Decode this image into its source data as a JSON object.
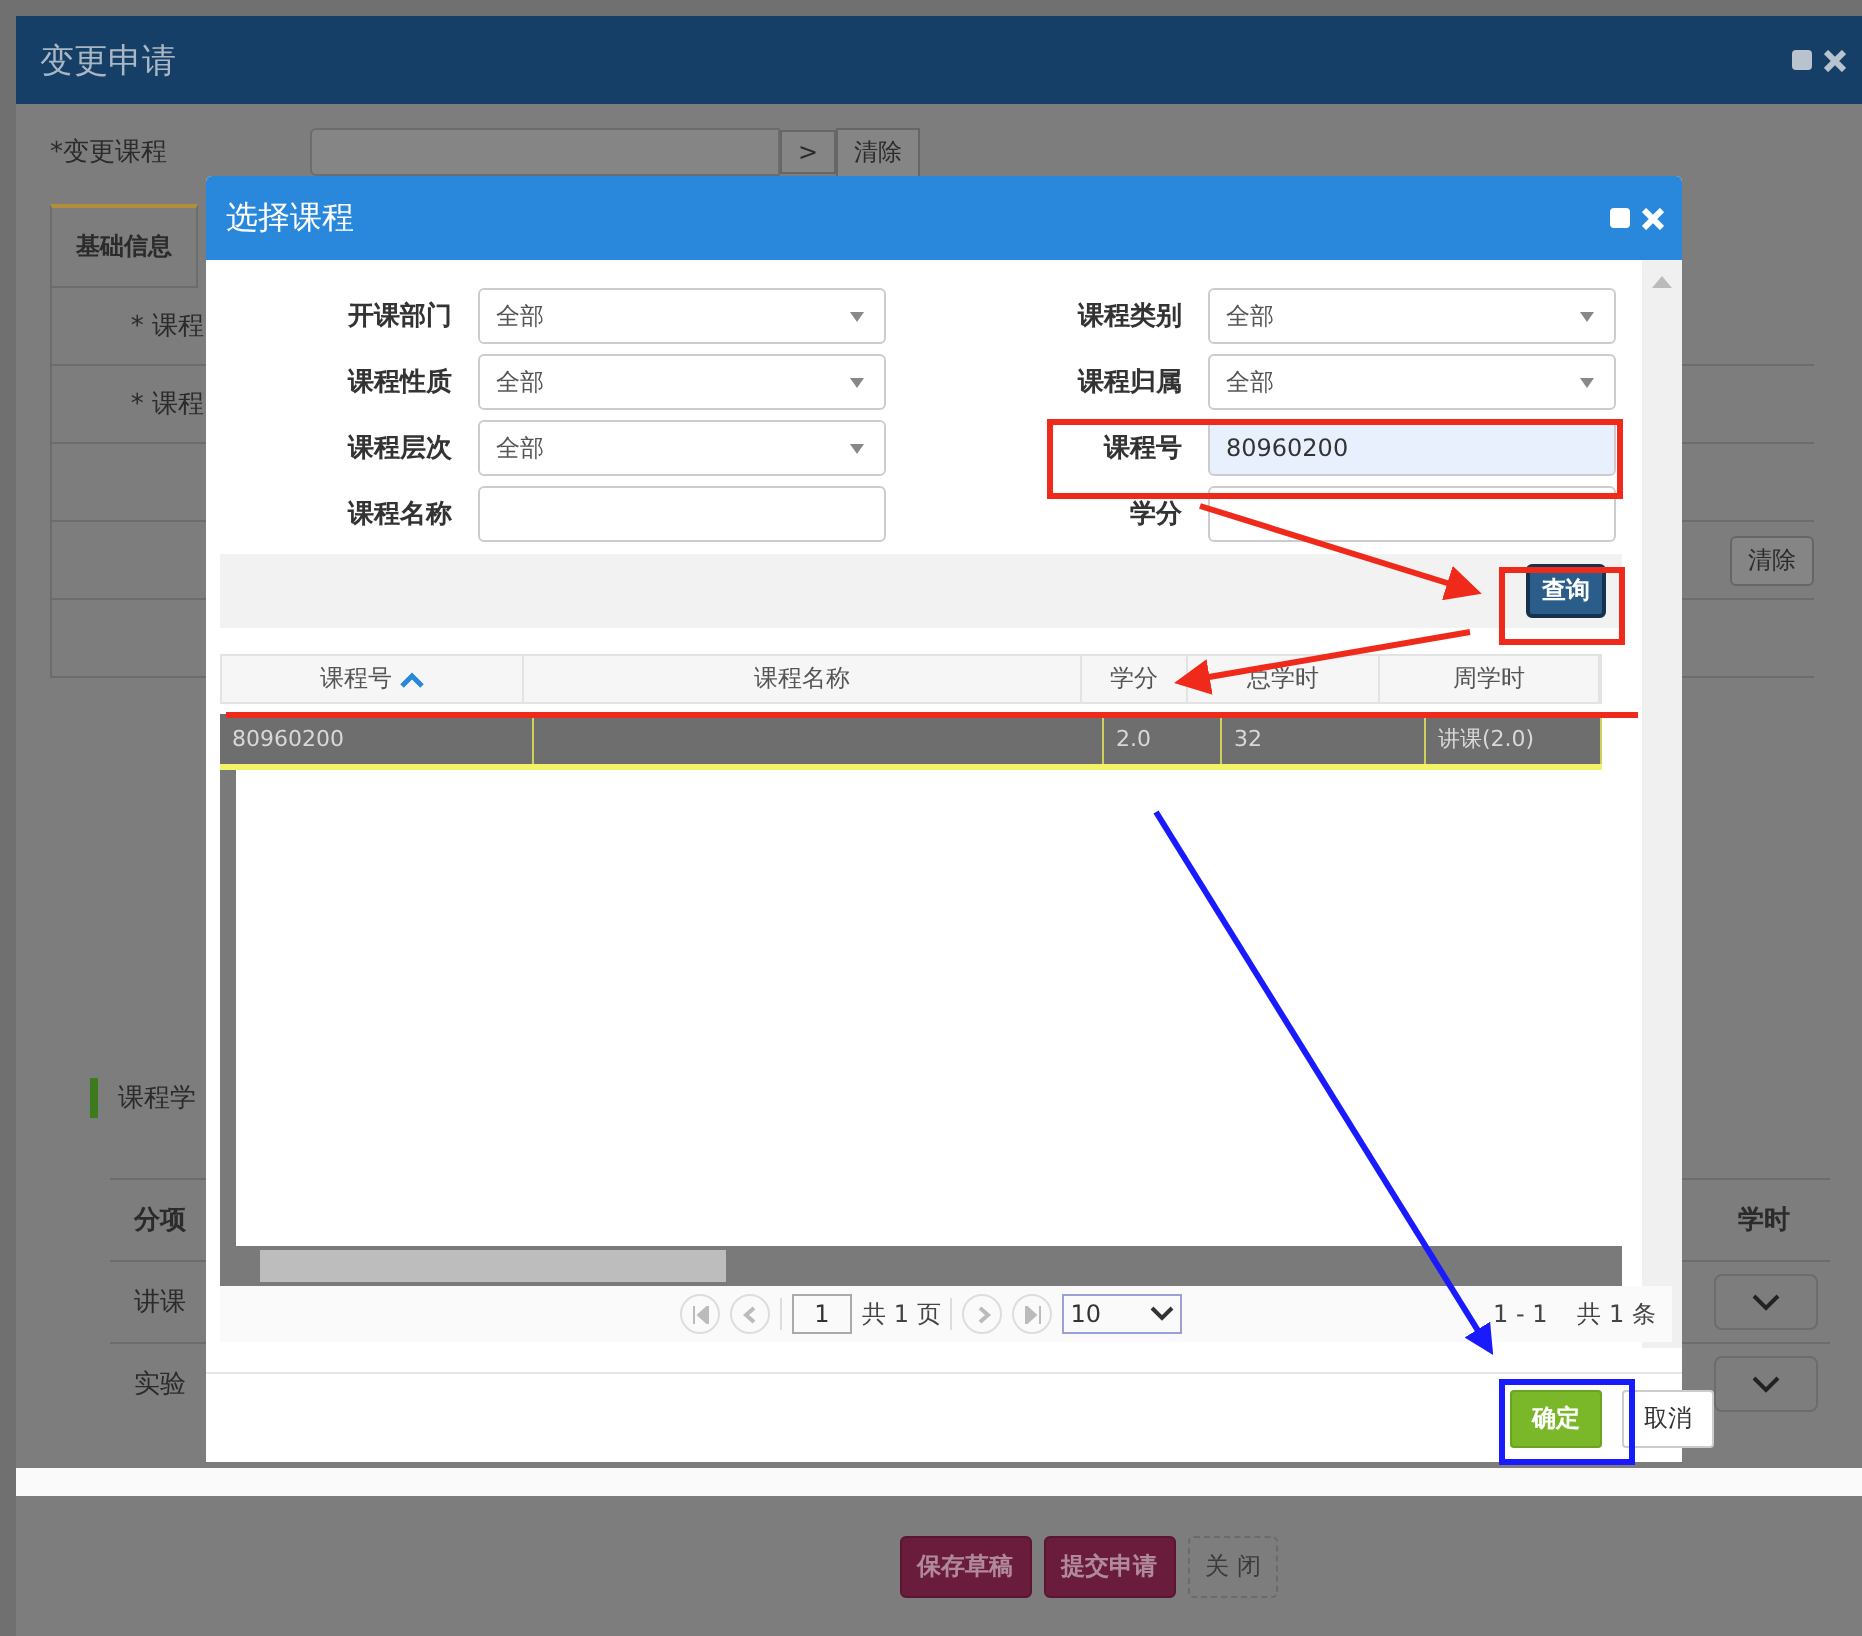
{
  "window": {
    "title": "变更申请"
  },
  "background_form": {
    "course_label": "*变更课程",
    "browse_button": ">",
    "clear_button": "清除",
    "tab": "基础信息",
    "field_labels": [
      "* 课程",
      "* 课程"
    ],
    "row_clear_button": "清除",
    "section_title": "课程学",
    "hours_table": {
      "header": "分项",
      "rows": [
        "讲课",
        "实验"
      ],
      "right_header": "学时"
    }
  },
  "dialog": {
    "title": "选择课程",
    "filters": [
      {
        "label": "开课部门",
        "kind": "select",
        "value": "全部"
      },
      {
        "label": "课程类别",
        "kind": "select",
        "value": "全部"
      },
      {
        "label": "课程性质",
        "kind": "select",
        "value": "全部"
      },
      {
        "label": "课程归属",
        "kind": "select",
        "value": "全部"
      },
      {
        "label": "课程层次",
        "kind": "select",
        "value": "全部"
      },
      {
        "label": "课程号",
        "kind": "input",
        "value": "80960200"
      },
      {
        "label": "课程名称",
        "kind": "input"
      },
      {
        "label": "学分",
        "kind": "input"
      }
    ],
    "search_button": "查询",
    "table": {
      "columns": [
        {
          "label": "课程号",
          "sorted": true
        },
        {
          "label": "课程名称",
          "sorted": false
        },
        {
          "label": "学分",
          "sorted": false
        },
        {
          "label": "总学时",
          "sorted": false
        },
        {
          "label": "周学时",
          "sorted": false
        }
      ],
      "rows": [
        {
          "course_no": "80960200",
          "credit": "2.0",
          "total_hours": "32",
          "weekly_hours": "讲课(2.0)"
        }
      ]
    },
    "pager": {
      "page": "1",
      "total_pages": "共 1 页",
      "page_size": "10",
      "range": "1 - 1",
      "total": "共 1 条"
    },
    "buttons": [
      "确定",
      "取消"
    ]
  },
  "footer_buttons": [
    "保存草稿",
    "提交申请",
    "关 闭"
  ]
}
